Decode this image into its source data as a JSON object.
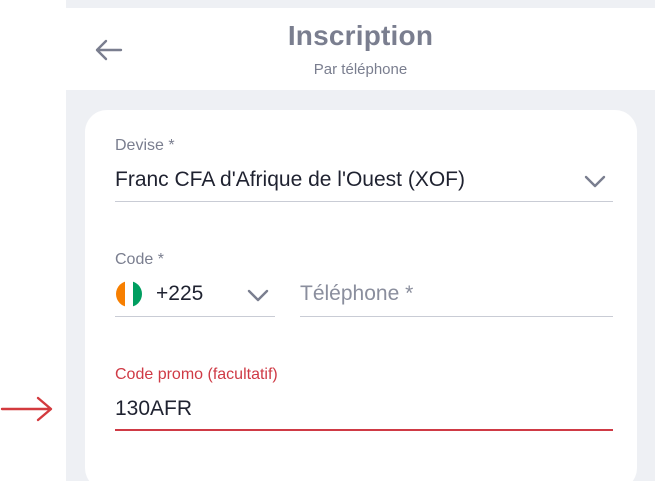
{
  "header": {
    "title": "Inscription",
    "subtitle": "Par téléphone"
  },
  "form": {
    "currency": {
      "label": "Devise *",
      "value": "Franc CFA d'Afrique de l'Ouest (XOF)"
    },
    "code": {
      "label": "Code *",
      "value": "+225",
      "flag_colors": [
        "#f77f00",
        "#ffffff",
        "#009e60"
      ]
    },
    "phone": {
      "placeholder": "Téléphone *"
    },
    "promo": {
      "label": "Code promo (facultatif)",
      "value": "130AFR"
    }
  },
  "colors": {
    "accent": "#cf3a45",
    "muted_text": "#7a7e8f",
    "background": "#eef0f4"
  },
  "icons": [
    "back-arrow-icon",
    "chevron-down-icon",
    "ivory-coast-flag-icon",
    "annotation-arrow-icon"
  ]
}
